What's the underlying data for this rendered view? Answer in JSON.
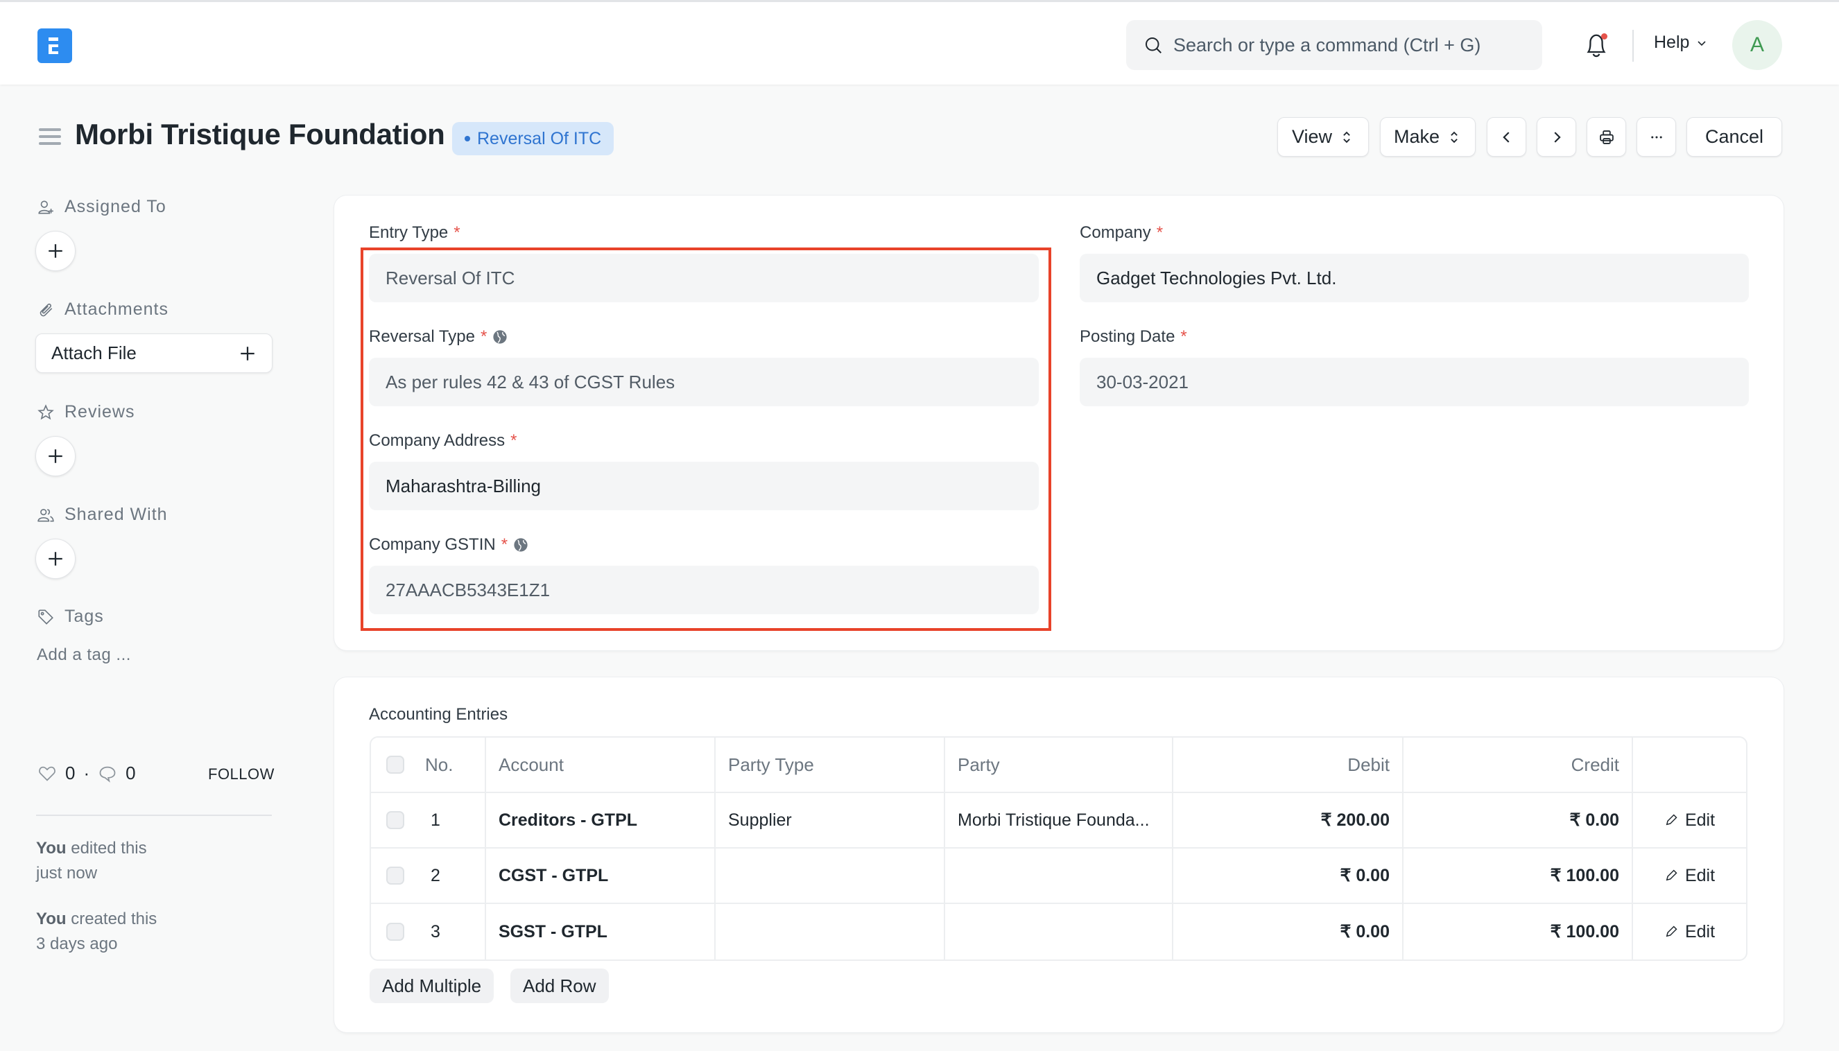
{
  "navbar": {
    "search_placeholder": "Search or type a command (Ctrl + G)",
    "help_label": "Help",
    "avatar_initial": "A",
    "has_notification": true
  },
  "page": {
    "title": "Morbi Tristique Foundation",
    "status": "Reversal Of ITC",
    "status_color": "#2f74d0"
  },
  "toolbar": {
    "view_label": "View",
    "make_label": "Make",
    "cancel_label": "Cancel"
  },
  "sidebar": {
    "assigned_to": "Assigned To",
    "attachments": "Attachments",
    "attach_file": "Attach File",
    "reviews": "Reviews",
    "shared_with": "Shared With",
    "tags": "Tags",
    "add_tag": "Add a tag ...",
    "likes": "0",
    "comments": "0",
    "separator": "·",
    "follow": "FOLLOW",
    "timeline": [
      {
        "actor": "You",
        "action": "edited this",
        "when": "just now"
      },
      {
        "actor": "You",
        "action": "created this",
        "when": "3 days ago"
      }
    ]
  },
  "form": {
    "entry_type": {
      "label": "Entry Type",
      "value": "Reversal Of ITC"
    },
    "reversal_type": {
      "label": "Reversal Type",
      "value": "As per rules 42 & 43 of CGST Rules"
    },
    "company_address": {
      "label": "Company Address",
      "value": "Maharashtra-Billing"
    },
    "company_gstin": {
      "label": "Company GSTIN",
      "value": "27AAACB5343E1Z1"
    },
    "company": {
      "label": "Company",
      "value": "Gadget Technologies Pvt. Ltd."
    },
    "posting_date": {
      "label": "Posting Date",
      "value": "30-03-2021"
    },
    "required_mark": "*",
    "highlight_color": "#e8432a"
  },
  "accounts": {
    "title": "Accounting Entries",
    "columns": [
      "No.",
      "Account",
      "Party Type",
      "Party",
      "Debit",
      "Credit"
    ],
    "rows": [
      {
        "no": "1",
        "account": "Creditors - GTPL",
        "party_type": "Supplier",
        "party": "Morbi Tristique Founda...",
        "debit": "₹ 200.00",
        "credit": "₹ 0.00",
        "edit": "Edit"
      },
      {
        "no": "2",
        "account": "CGST - GTPL",
        "party_type": "",
        "party": "",
        "debit": "₹ 0.00",
        "credit": "₹ 100.00",
        "edit": "Edit"
      },
      {
        "no": "3",
        "account": "SGST - GTPL",
        "party_type": "",
        "party": "",
        "debit": "₹ 0.00",
        "credit": "₹ 100.00",
        "edit": "Edit"
      }
    ],
    "add_multiple": "Add Multiple",
    "add_row": "Add Row"
  }
}
